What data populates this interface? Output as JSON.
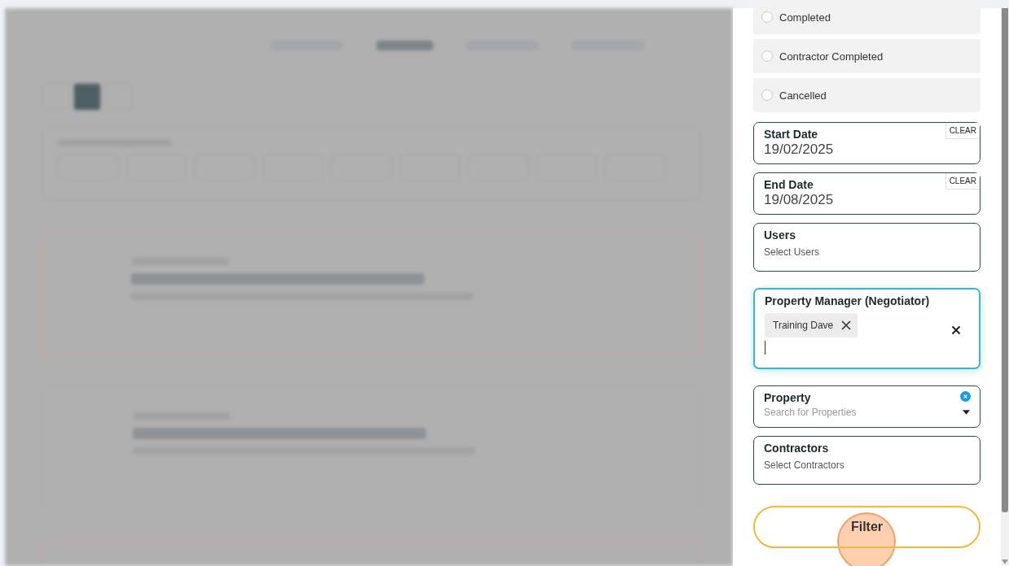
{
  "status_options": [
    {
      "label": "Completed",
      "selected": false
    },
    {
      "label": "Contractor Completed",
      "selected": false
    },
    {
      "label": "Cancelled",
      "selected": false
    }
  ],
  "date_fields": [
    {
      "label": "Start Date",
      "value": "19/02/2025",
      "clear_label": "CLEAR"
    },
    {
      "label": "End Date",
      "value": "19/08/2025",
      "clear_label": "CLEAR"
    }
  ],
  "users": {
    "label": "Users",
    "placeholder": "Select Users"
  },
  "property_manager": {
    "label": "Property Manager (Negotiator)",
    "focused": true,
    "chips": [
      {
        "label": "Training Dave"
      }
    ]
  },
  "property": {
    "label": "Property",
    "placeholder": "Search for Properties"
  },
  "contractors": {
    "label": "Contractors",
    "placeholder": "Select Contractors"
  },
  "filter_button": {
    "label": "Filter"
  }
}
